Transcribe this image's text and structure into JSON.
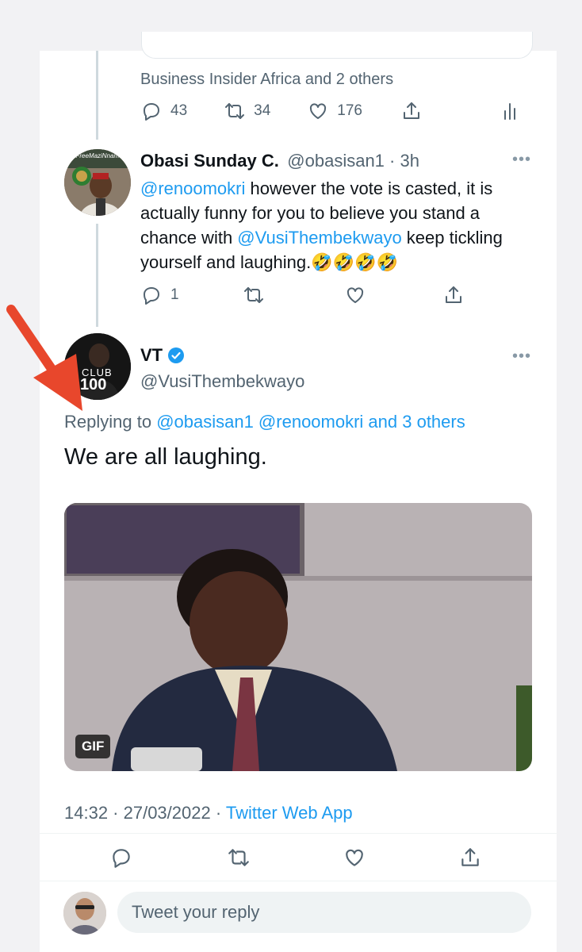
{
  "quoted_tweet": {
    "quoted_by": "Business Insider Africa and 2 others",
    "reply_count": "43",
    "retweet_count": "34",
    "like_count": "176"
  },
  "reply_tweet": {
    "name": "Obasi Sunday C.",
    "handle_time": "@obasisan1 · 3h",
    "mention": "@renoomokri",
    "text_1": " however the vote is casted, it is actually funny for you to believe you stand a chance with ",
    "mention_2": "@VusiThembekwayo",
    "text_2": " keep tickling yourself and laughing.",
    "emojis": "🤣🤣🤣🤣",
    "avatar_banner": "#FreeMaziNnamdi",
    "reply_count": "1"
  },
  "main_tweet": {
    "name": "VT",
    "handle": "@VusiThembekwayo",
    "avatar_text_top": "CLUB",
    "avatar_text_bottom": "100",
    "replying_label": "Replying to ",
    "replying_handles": "@obasisan1 @renoomokri and 3 others",
    "text": "We are all laughing.",
    "gif_label": "GIF",
    "timestamp": "14:32 · 27/03/2022 · ",
    "source": "Twitter Web App"
  },
  "composer": {
    "placeholder": "Tweet your reply"
  },
  "colors": {
    "link": "#1d9bf0",
    "secondary": "#536471",
    "verified": "#1d9bf0",
    "arrow": "#e8472c"
  }
}
